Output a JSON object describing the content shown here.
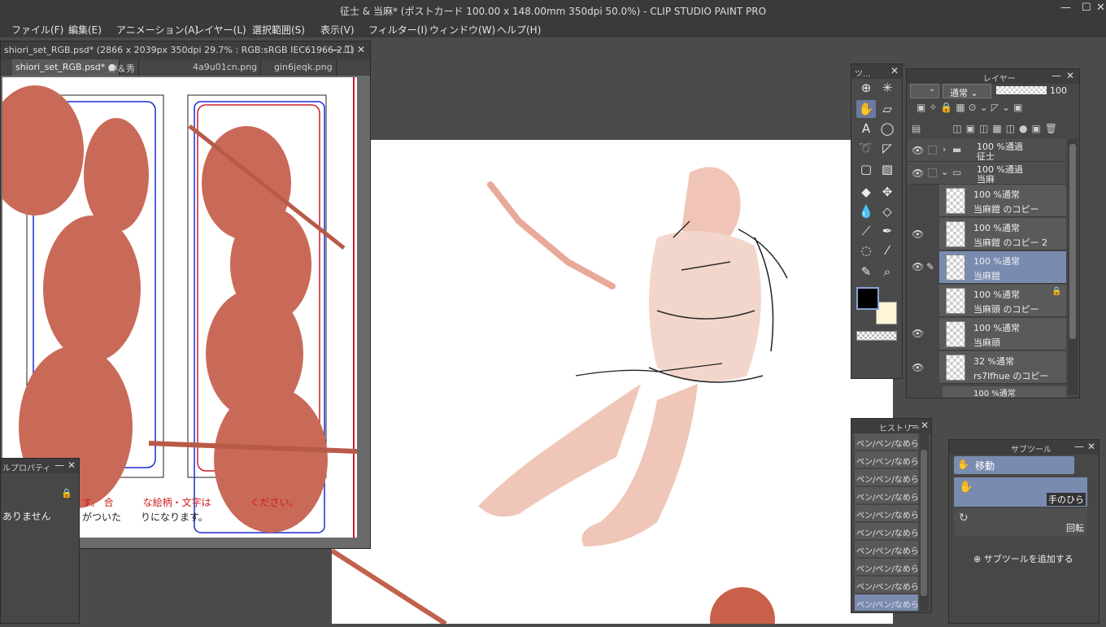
{
  "window": {
    "title": "征士 & 当麻* (ポストカード 100.00 x 148.00mm 350dpi 50.0%)  - CLIP STUDIO PAINT PRO",
    "minimize": "—",
    "maximize": "☐",
    "close": "✕"
  },
  "menu": [
    "ファイル(F)",
    "編集(E)",
    "アニメーション(A)",
    "レイヤー(L)",
    "選択範囲(S)",
    "表示(V)",
    "フィルター(I)",
    "ウィンドウ(W)",
    "ヘルプ(H)"
  ],
  "sub_window": {
    "title": "shiori_set_RGB.psd* (2866 x 2039px 350dpi 29.7% : RGB:sRGB IEC61966-2.1)",
    "tabs": [
      "shiori_set_RGB.psd*",
      "伸＆秀",
      "4a9u01cn.png",
      "gin6jeqk.png"
    ],
    "red_note": "す。 合　　　な絵柄・文字は　　　　ください。",
    "black_note": "がついた　　りになります。"
  },
  "layer_property": {
    "title": "ルプロパティ",
    "none": "ありません"
  },
  "tool_palette": {
    "title": "ツ..."
  },
  "layer_palette": {
    "title": "レイヤー",
    "blend_mode": "通常",
    "opacity": "100",
    "layers": [
      {
        "line1": "100 %通過",
        "line2": "征士",
        "type": "folder"
      },
      {
        "line1": "100 %通過",
        "line2": "当麻",
        "type": "folder"
      },
      {
        "line1": "100 %通常",
        "line2": "当麻鎧 のコピー",
        "type": "raster"
      },
      {
        "line1": "100 %通常",
        "line2": "当麻鎧 のコピー 2",
        "type": "raster"
      },
      {
        "line1": "100 %通常",
        "line2": "当麻鎧",
        "type": "raster",
        "selected": true
      },
      {
        "line1": "100 %通常",
        "line2": "当麻頭 のコピー",
        "type": "raster",
        "locked": true
      },
      {
        "line1": "100 %通常",
        "line2": "当麻頭",
        "type": "raster"
      },
      {
        "line1": "32 %通常",
        "line2": "rs7lfhue のコピー",
        "type": "raster"
      },
      {
        "line1": "100 %通常",
        "line2": "",
        "type": "raster"
      }
    ]
  },
  "history_palette": {
    "title": "ヒストリー",
    "items": [
      "ペン/ペン/なめらか",
      "ペン/ペン/なめらか",
      "ペン/ペン/なめらか",
      "ペン/ペン/なめらか",
      "ペン/ペン/なめらか",
      "ペン/ペン/なめらか",
      "ペン/ペン/なめらか",
      "ペン/ペン/なめらか",
      "ペン/ペン/なめらか",
      "ペン/ペン/なめらか"
    ]
  },
  "subtool_palette": {
    "title": "サブツール",
    "group": "移動",
    "tools": [
      {
        "label": "手のひら",
        "selected": true
      },
      {
        "label": "回転",
        "selected": false
      }
    ],
    "add_button": "サブツールを追加する"
  },
  "colors": {
    "main": "#000000",
    "sub": "#fff6d8",
    "accent": "#7a8bb0"
  }
}
